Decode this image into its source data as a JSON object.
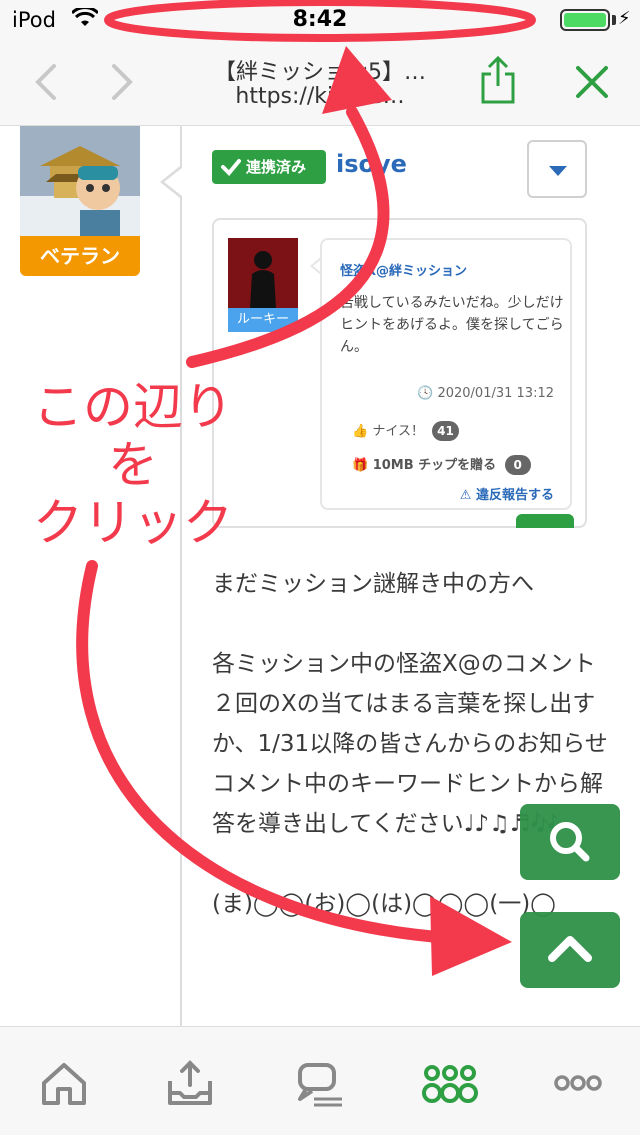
{
  "status_bar": {
    "device": "iPod",
    "time": "8:42"
  },
  "browser": {
    "page_title": "【絆ミッション5】…",
    "url": "https://kin…e…",
    "colors": {
      "accent": "#2ea043"
    }
  },
  "post": {
    "author_rank": "ベテラン",
    "linked_badge": "連携済み",
    "username": "isoye",
    "quoted": {
      "rank": "ルーキー",
      "name": "怪盗X@絆ミッション",
      "body": "苦戦しているみたいだね。少しだけヒントをあげるよ。僕を探してごらん。",
      "date": "2020/01/31 13:12",
      "nice_label": "ナイス！",
      "nice_count": "41",
      "chip_label": "10MB チップを贈る",
      "chip_count": "0",
      "report_label": "違反報告する"
    },
    "paragraphs": [
      "まだミッション謎解き中の方へ",
      "各ミッション中の怪盗X@のコメント２回のXの当てはまる言葉を探し出すか、1/31以降の皆さんからのお知らせコメント中のキーワードヒントから解答を導き出してください♩♪♫♬🎶",
      "(ま)◯◯(お)◯(は)◯◯◯(一)◯"
    ]
  },
  "annotation": {
    "line1": "この辺り",
    "line2": "を",
    "line3": "クリック",
    "color": "#f23a4c"
  },
  "icons": {
    "back": "chevron-left-icon",
    "forward": "chevron-right-icon",
    "share": "share-icon",
    "close": "close-icon",
    "search": "search-icon",
    "scroll_top": "chevron-up-icon",
    "tabs": [
      "home-icon",
      "upload-tray-icon",
      "chat-icon",
      "community-icon",
      "more-icon"
    ]
  }
}
